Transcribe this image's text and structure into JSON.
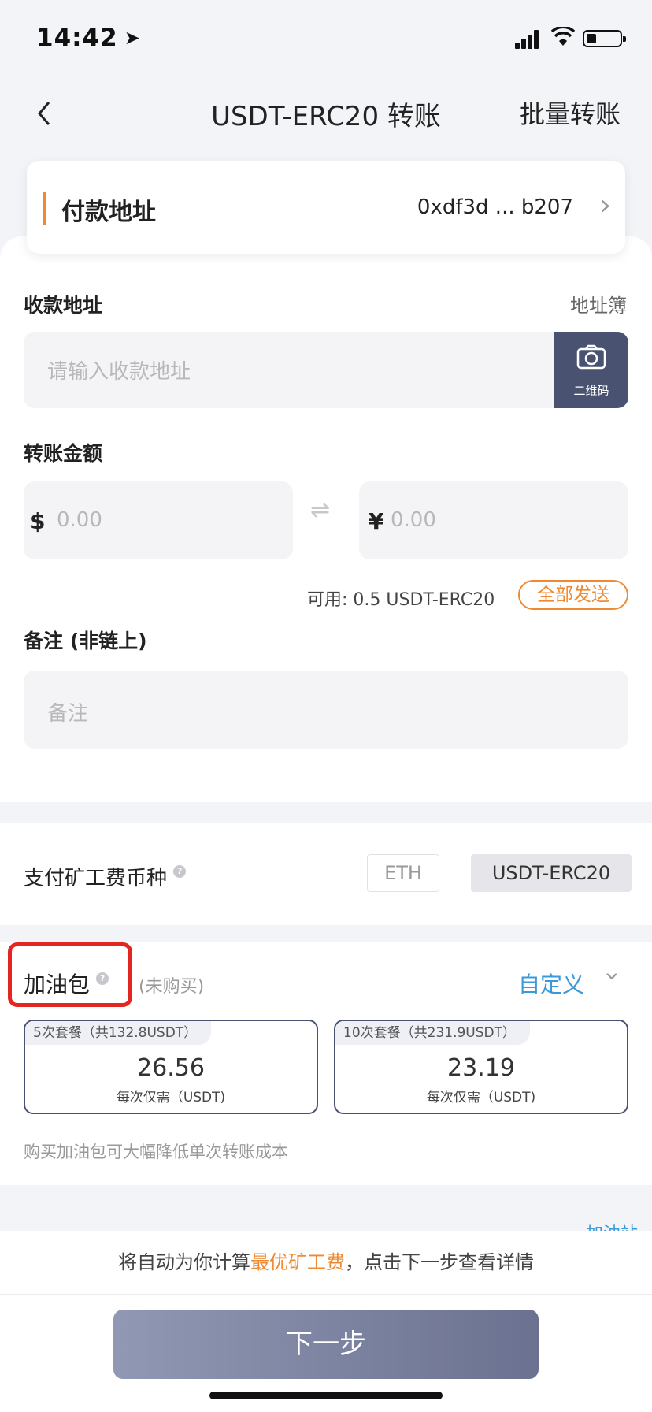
{
  "status_bar": {
    "time": "14:42",
    "location_icon": "location-arrow-icon",
    "signal_icon": "signal-icon",
    "wifi_icon": "wifi-icon",
    "battery_icon": "battery-icon"
  },
  "nav": {
    "back_icon": "chevron-left-icon",
    "title": "USDT-ERC20 转账",
    "right_action": "批量转账"
  },
  "payer": {
    "label": "付款地址",
    "address": "0xdf3d ... b207"
  },
  "payee": {
    "label": "收款地址",
    "address_book": "地址簿",
    "placeholder": "请输入收款地址",
    "qr_label": "二维码"
  },
  "amount": {
    "label": "转账金额",
    "usd_symbol": "$",
    "usd_placeholder": "0.00",
    "cny_symbol": "¥",
    "cny_placeholder": "0.00",
    "swap_icon": "swap-arrows-icon",
    "available": "可用: 0.5 USDT-ERC20",
    "send_all": "全部发送"
  },
  "memo": {
    "label": "备注 (非链上)",
    "placeholder": "备注"
  },
  "fee_coin": {
    "label": "支付矿工费币种",
    "options": [
      "ETH",
      "USDT-ERC20"
    ],
    "selected": "USDT-ERC20"
  },
  "gas_pack": {
    "label": "加油包",
    "status": "(未购买)",
    "custom": "自定义",
    "packages": [
      {
        "tag": "5次套餐（共132.8USDT）",
        "price": "26.56",
        "per": "每次仅需（USDT)"
      },
      {
        "tag": "10次套餐（共231.9USDT）",
        "price": "23.19",
        "per": "每次仅需（USDT)"
      }
    ],
    "hint": "购买加油包可大幅降低单次转账成本"
  },
  "partial_link": "加油站",
  "bottom": {
    "notice_prefix": "将自动为你计算",
    "notice_highlight": "最优矿工费",
    "notice_suffix": "，点击下一步查看详情",
    "next_button": "下一步"
  },
  "colors": {
    "accent_orange": "#ef8a32",
    "accent_blue": "#3a9ad9",
    "navy": "#4a5272",
    "highlight_red": "#e3261f"
  }
}
